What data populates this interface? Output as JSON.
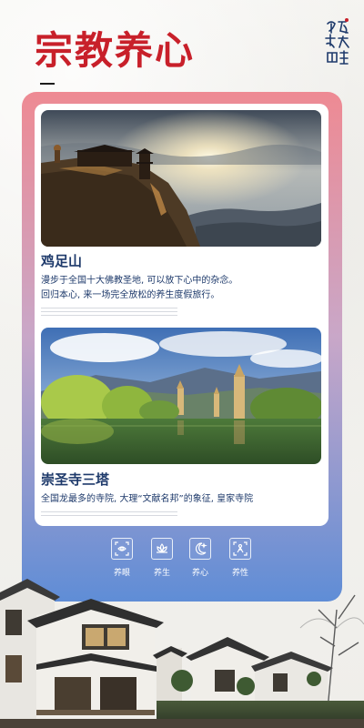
{
  "header": {
    "title": "宗教养心",
    "logo_text": "旅居大理"
  },
  "places": [
    {
      "name": "鸡足山",
      "description_lines": [
        "漫步于全国十大佛教圣地, 可以放下心中的杂念。",
        "回归本心, 来一场完全放松的养生度假旅行。"
      ]
    },
    {
      "name": "崇圣寺三塔",
      "description_lines": [
        "全国龙最多的寺院, 大理“文献名邦”的象征, 皇家寺院"
      ]
    }
  ],
  "features": [
    {
      "label": "养眼",
      "icon": "eye-scan-icon"
    },
    {
      "label": "养生",
      "icon": "lotus-icon"
    },
    {
      "label": "养心",
      "icon": "moon-icon"
    },
    {
      "label": "养性",
      "icon": "figure-frame-icon"
    }
  ],
  "colors": {
    "title_red": "#c8202a",
    "text_navy": "#1e3a6b",
    "frame_top": "#ee8a93",
    "frame_bottom": "#5f8dd6"
  }
}
